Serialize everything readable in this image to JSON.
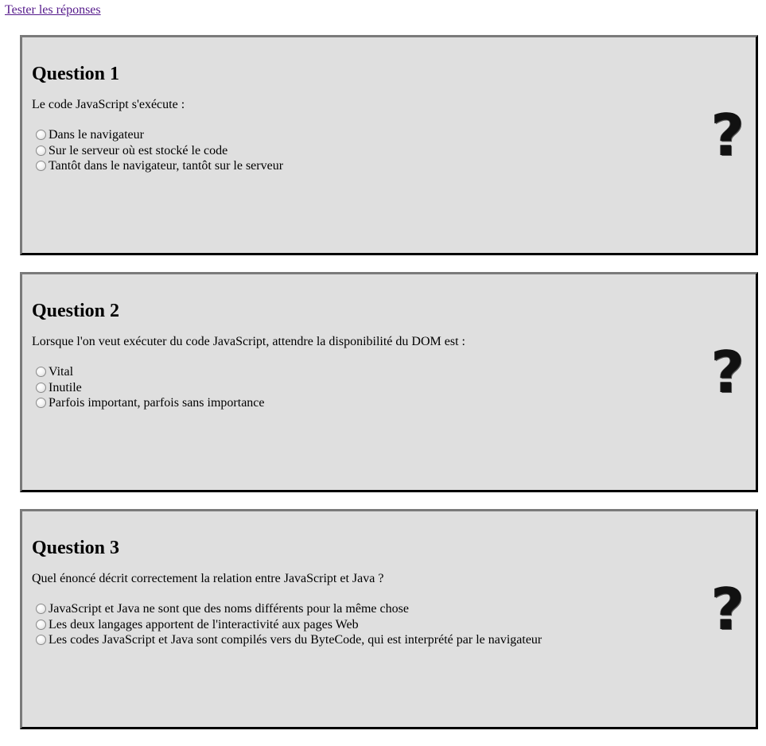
{
  "toolbar": {
    "test_label": "Tester les réponses"
  },
  "questions": [
    {
      "title": "Question 1",
      "text": "Le code JavaScript s'exécute :",
      "options": [
        "Dans le navigateur",
        "Sur le serveur où est stocké le code",
        "Tantôt dans le navigateur, tantôt sur le serveur"
      ],
      "icon": "question-mark-icon"
    },
    {
      "title": "Question 2",
      "text": "Lorsque l'on veut exécuter du code JavaScript, attendre la disponibilité du DOM est :",
      "options": [
        "Vital",
        "Inutile",
        "Parfois important, parfois sans importance"
      ],
      "icon": "question-mark-icon"
    },
    {
      "title": "Question 3",
      "text": "Quel énoncé décrit correctement la relation entre JavaScript et Java ?",
      "options": [
        "JavaScript et Java ne sont que des noms différents pour la même chose",
        "Les deux langages apportent de l'interactivité aux pages Web",
        "Les codes JavaScript et Java sont compilés vers du ByteCode, qui est interprété par le navigateur"
      ],
      "icon": "question-mark-icon"
    }
  ],
  "colors": {
    "box_background": "#dfdfdf",
    "link": "#551a8b"
  }
}
